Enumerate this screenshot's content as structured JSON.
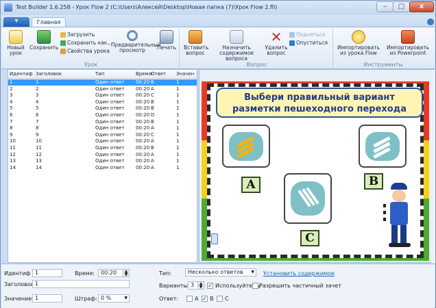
{
  "window": {
    "title": "Test Builder 1.6.258 - Урок Flow 2 (C:\\Users\\Алексей\\Desktop\\Новая папка (7)\\Урок Flow 2.fll)",
    "min_label": "–",
    "max_label": "□",
    "close_label": "x"
  },
  "ribbon": {
    "app_menu": "▾",
    "tab_home": "Главная",
    "lesson_group": {
      "title": "Урок",
      "new_label": "Новый урок",
      "save_label": "Сохранить",
      "load_label": "Загрузить",
      "save_as_label": "Сохранить как...",
      "props_label": "Свойства урока",
      "preview_label": "Предварительный просмотр",
      "print_label": "Печать"
    },
    "question_group": {
      "title": "Вопрос",
      "insert_label": "Вставить вопрос",
      "assign_label": "Назначить содержимое вопроса",
      "delete_label": "Удалить вопрос",
      "up_label": "Подняться",
      "down_label": "Опуститься"
    },
    "tools_group": {
      "title": "Инструменты",
      "import_flow_label": "Импортировать из урока Flow",
      "import_ppt_label": "Импортировать из Powerpoint"
    }
  },
  "grid": {
    "columns": [
      "Идентиф",
      "Заголовок",
      "Тип",
      "Время",
      "Ответ",
      "Значен"
    ],
    "rows": [
      {
        "id": "1",
        "title": "1",
        "type": "Один ответ",
        "time": "00:20",
        "answer": "B",
        "value": "1"
      },
      {
        "id": "2",
        "title": "2",
        "type": "Один ответ",
        "time": "00:20",
        "answer": "A",
        "value": "1"
      },
      {
        "id": "3",
        "title": "3",
        "type": "Один ответ",
        "time": "00:20",
        "answer": "C",
        "value": "1"
      },
      {
        "id": "4",
        "title": "4",
        "type": "Один ответ",
        "time": "00:20",
        "answer": "B",
        "value": "1"
      },
      {
        "id": "5",
        "title": "5",
        "type": "Один ответ",
        "time": "00:20",
        "answer": "B",
        "value": "1"
      },
      {
        "id": "6",
        "title": "6",
        "type": "Один ответ",
        "time": "00:20",
        "answer": "D",
        "value": "1"
      },
      {
        "id": "7",
        "title": "7",
        "type": "Один ответ",
        "time": "00:20",
        "answer": "B",
        "value": "1"
      },
      {
        "id": "8",
        "title": "8",
        "type": "Один ответ",
        "time": "00:20",
        "answer": "A",
        "value": "1"
      },
      {
        "id": "9",
        "title": "9",
        "type": "Один ответ",
        "time": "00:20",
        "answer": "C",
        "value": "1"
      },
      {
        "id": "10",
        "title": "10",
        "type": "Один ответ",
        "time": "00:20",
        "answer": "A",
        "value": "1"
      },
      {
        "id": "11",
        "title": "11",
        "type": "Один ответ",
        "time": "00:20",
        "answer": "B",
        "value": "1"
      },
      {
        "id": "12",
        "title": "12",
        "type": "Один ответ",
        "time": "00:20",
        "answer": "A",
        "value": "1"
      },
      {
        "id": "13",
        "title": "13",
        "type": "Один ответ",
        "time": "00:20",
        "answer": "A",
        "value": "1"
      },
      {
        "id": "14",
        "title": "14",
        "type": "Один ответ",
        "time": "00:20",
        "answer": "A",
        "value": "1"
      }
    ],
    "selected_index": 0
  },
  "slide": {
    "question": "Выбери правильный вариант разметки пешеходного перехода",
    "option_a": "A",
    "option_b": "B",
    "option_c": "C"
  },
  "props": {
    "id_label": "Идентиф",
    "id_value": "1",
    "time_label": "Время:",
    "time_value": "00:20",
    "title_label": "Заголовок:",
    "title_value": "1",
    "value_label": "Значение:",
    "value_value": "1",
    "penalty_label": "Штраф:",
    "penalty_value": "0 %",
    "type_label": "Тип:",
    "type_value": "Несколько ответов",
    "set_content_link": "Установить содержимое",
    "variants_label": "Варианты:",
    "variants_value": "3",
    "use_check_label": "Используйте бу",
    "partial_label": "Разрешить частичный зачет",
    "answer_label": "Ответ:",
    "answer_a": "A",
    "answer_b": "B",
    "answer_c": "C",
    "answer_a_checked": false,
    "answer_b_checked": true,
    "answer_c_checked": false,
    "use_check_checked": true,
    "partial_checked": false
  },
  "colors": {
    "selection": "#3399ff",
    "link": "#1b5fb5",
    "slide_red": "#e63a26",
    "slide_yellow": "#f4d21a",
    "slide_green": "#4faa34"
  }
}
